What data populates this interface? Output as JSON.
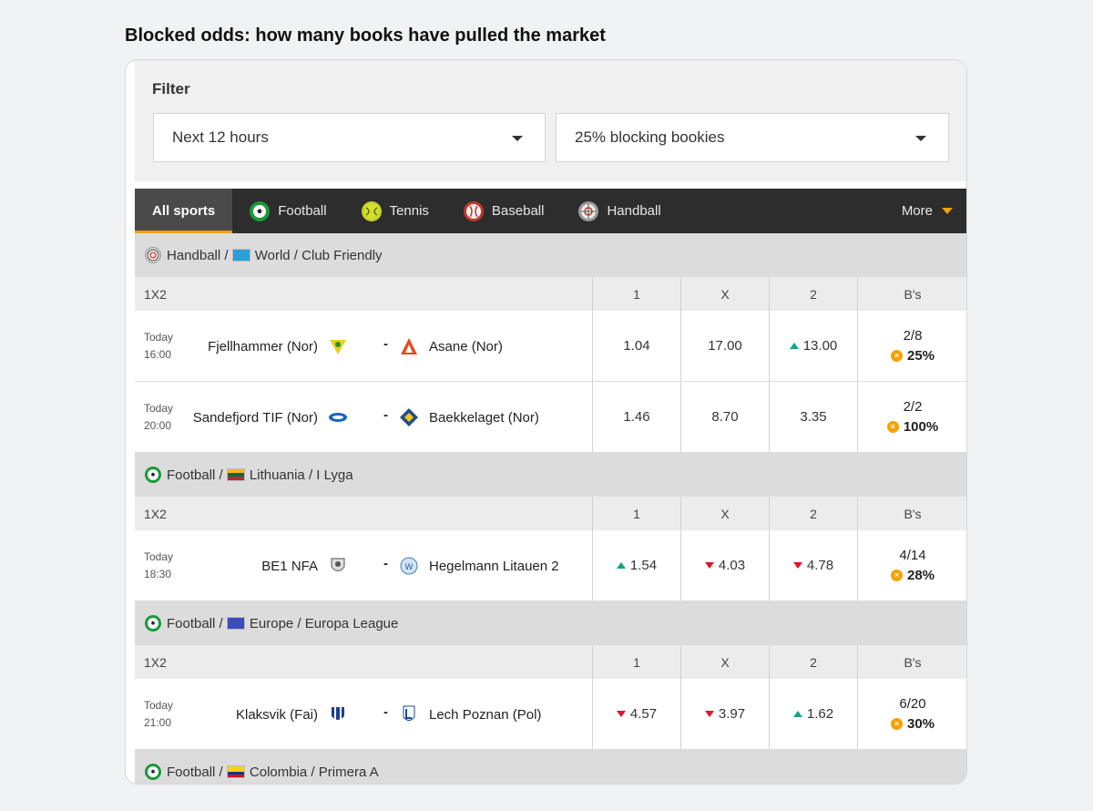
{
  "page_title": "Blocked odds: how many books have pulled the market",
  "filter": {
    "title": "Filter",
    "time_select": "Next 12 hours",
    "blocking_select": "25% blocking bookies"
  },
  "tabs": [
    {
      "label": "All sports",
      "icon": ""
    },
    {
      "label": "Football",
      "icon": "football-icon"
    },
    {
      "label": "Tennis",
      "icon": "tennis-icon"
    },
    {
      "label": "Baseball",
      "icon": "baseball-icon"
    },
    {
      "label": "Handball",
      "icon": "handball-icon"
    }
  ],
  "more_label": "More",
  "headers": {
    "market": "1X2",
    "c1": "1",
    "cx": "X",
    "c2": "2",
    "bs": "B's"
  },
  "leagues": [
    {
      "sport": "Handball",
      "region": "World",
      "league": "Club Friendly",
      "matches": [
        {
          "day": "Today",
          "time": "16:00",
          "home": "Fjellhammer (Nor)",
          "away": "Asane (Nor)",
          "o1": "1.04",
          "ox": "17.00",
          "o2": "13.00",
          "t1": "",
          "tx": "",
          "t2": "up",
          "blocked": "2/8",
          "pct": "25%"
        },
        {
          "day": "Today",
          "time": "20:00",
          "home": "Sandefjord TIF (Nor)",
          "away": "Baekkelaget (Nor)",
          "o1": "1.46",
          "ox": "8.70",
          "o2": "3.35",
          "t1": "",
          "tx": "",
          "t2": "",
          "blocked": "2/2",
          "pct": "100%"
        }
      ]
    },
    {
      "sport": "Football",
      "region": "Lithuania",
      "league": "I Lyga",
      "matches": [
        {
          "day": "Today",
          "time": "18:30",
          "home": "BE1 NFA",
          "away": "Hegelmann Litauen 2",
          "o1": "1.54",
          "ox": "4.03",
          "o2": "4.78",
          "t1": "up",
          "tx": "down",
          "t2": "down",
          "blocked": "4/14",
          "pct": "28%"
        }
      ]
    },
    {
      "sport": "Football",
      "region": "Europe",
      "league": "Europa League",
      "matches": [
        {
          "day": "Today",
          "time": "21:00",
          "home": "Klaksvik (Fai)",
          "away": "Lech Poznan (Pol)",
          "o1": "4.57",
          "ox": "3.97",
          "o2": "1.62",
          "t1": "down",
          "tx": "down",
          "t2": "up",
          "blocked": "6/20",
          "pct": "30%"
        }
      ]
    },
    {
      "sport": "Football",
      "region": "Colombia",
      "league": "Primera A",
      "matches": []
    }
  ],
  "colors": {
    "accent": "#f5a100",
    "up": "#14a08c",
    "down": "#e1162b",
    "tabbar": "#2d2d2d"
  }
}
